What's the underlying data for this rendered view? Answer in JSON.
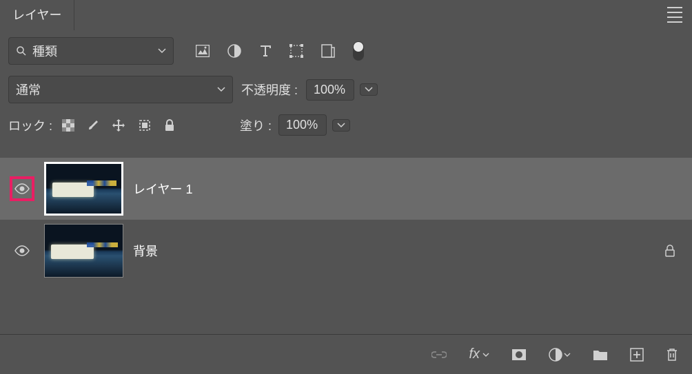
{
  "panel": {
    "title": "レイヤー"
  },
  "filter": {
    "search_placeholder": "種類"
  },
  "blend": {
    "mode": "通常",
    "opacity_label": "不透明度 :",
    "opacity_value": "100%"
  },
  "lock": {
    "label": "ロック :",
    "fill_label": "塗り :",
    "fill_value": "100%"
  },
  "layers": [
    {
      "name": "レイヤー 1",
      "selected": true,
      "locked": false,
      "visibility_highlighted": true
    },
    {
      "name": "背景",
      "selected": false,
      "locked": true,
      "visibility_highlighted": false
    }
  ]
}
